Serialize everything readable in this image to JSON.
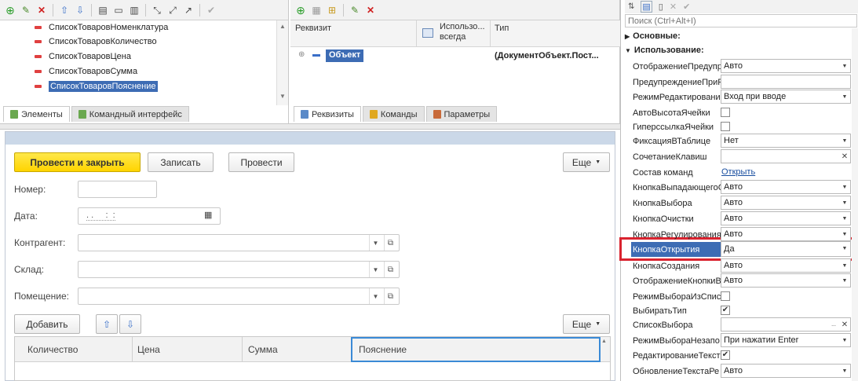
{
  "elements_panel": {
    "tree_items": [
      "СписокТоваровНоменклатура",
      "СписокТоваровКоличество",
      "СписокТоваровЦена",
      "СписокТоваровСумма",
      "СписокТоваровПояснение"
    ],
    "tabs": [
      "Элементы",
      "Командный интерфейс"
    ]
  },
  "requisites_panel": {
    "col_requisite": "Реквизит",
    "col_always": "Использо... всегда",
    "col_type": "Тип",
    "object_name": "Объект",
    "object_type": "(ДокументОбъект.Пост...",
    "tabs": [
      "Реквизиты",
      "Команды",
      "Параметры"
    ]
  },
  "form": {
    "post_close": "Провести и закрыть",
    "write": "Записать",
    "post": "Провести",
    "more": "Еще",
    "number_label": "Номер:",
    "date_label": "Дата:",
    "date_value": ". .     :  :",
    "counterparty_label": "Контрагент:",
    "warehouse_label": "Склад:",
    "room_label": "Помещение:",
    "add": "Добавить",
    "more2": "Еще",
    "table_columns": [
      "Количество",
      "Цена",
      "Сумма",
      "Пояснение"
    ]
  },
  "properties": {
    "search_placeholder": "Поиск (Ctrl+Alt+I)",
    "group_main": "Основные:",
    "group_usage": "Использование:",
    "rows": [
      {
        "name": "ОтображениеПредупр",
        "value": "Авто"
      },
      {
        "name": "ПредупреждениеПриР",
        "value": ""
      },
      {
        "name": "РежимРедактировани",
        "value": "Вход при вводе"
      },
      {
        "name": "АвтоВысотаЯчейки",
        "value": ""
      },
      {
        "name": "ГиперссылкаЯчейки",
        "value": ""
      },
      {
        "name": "ФиксацияВТаблице",
        "value": "Нет"
      },
      {
        "name": "СочетаниеКлавиш",
        "value": ""
      },
      {
        "name": "Состав команд",
        "value": "Открыть"
      },
      {
        "name": "КнопкаВыпадающегоС",
        "value": "Авто"
      },
      {
        "name": "КнопкаВыбора",
        "value": "Авто"
      },
      {
        "name": "КнопкаОчистки",
        "value": "Авто"
      },
      {
        "name": "КнопкаРегулирования",
        "value": "Авто"
      },
      {
        "name": "КнопкаОткрытия",
        "value": "Да"
      },
      {
        "name": "КнопкаСоздания",
        "value": "Авто"
      },
      {
        "name": "ОтображениеКнопкиВ",
        "value": "Авто"
      },
      {
        "name": "РежимВыбораИзСпис",
        "value": ""
      },
      {
        "name": "ВыбиратьТип",
        "value": "✔"
      },
      {
        "name": "СписокВыбора",
        "value": "..."
      },
      {
        "name": "РежимВыбораНезапо",
        "value": "При нажатии Enter"
      },
      {
        "name": "РедактированиеТекст",
        "value": "✔"
      },
      {
        "name": "ОбновлениеТекстаРе",
        "value": "Авто"
      }
    ]
  },
  "colors": {
    "accent": "#ffd800",
    "highlight": "#d9232f",
    "selected": "#3d6cb4",
    "form_header": "#cbd8e8"
  }
}
